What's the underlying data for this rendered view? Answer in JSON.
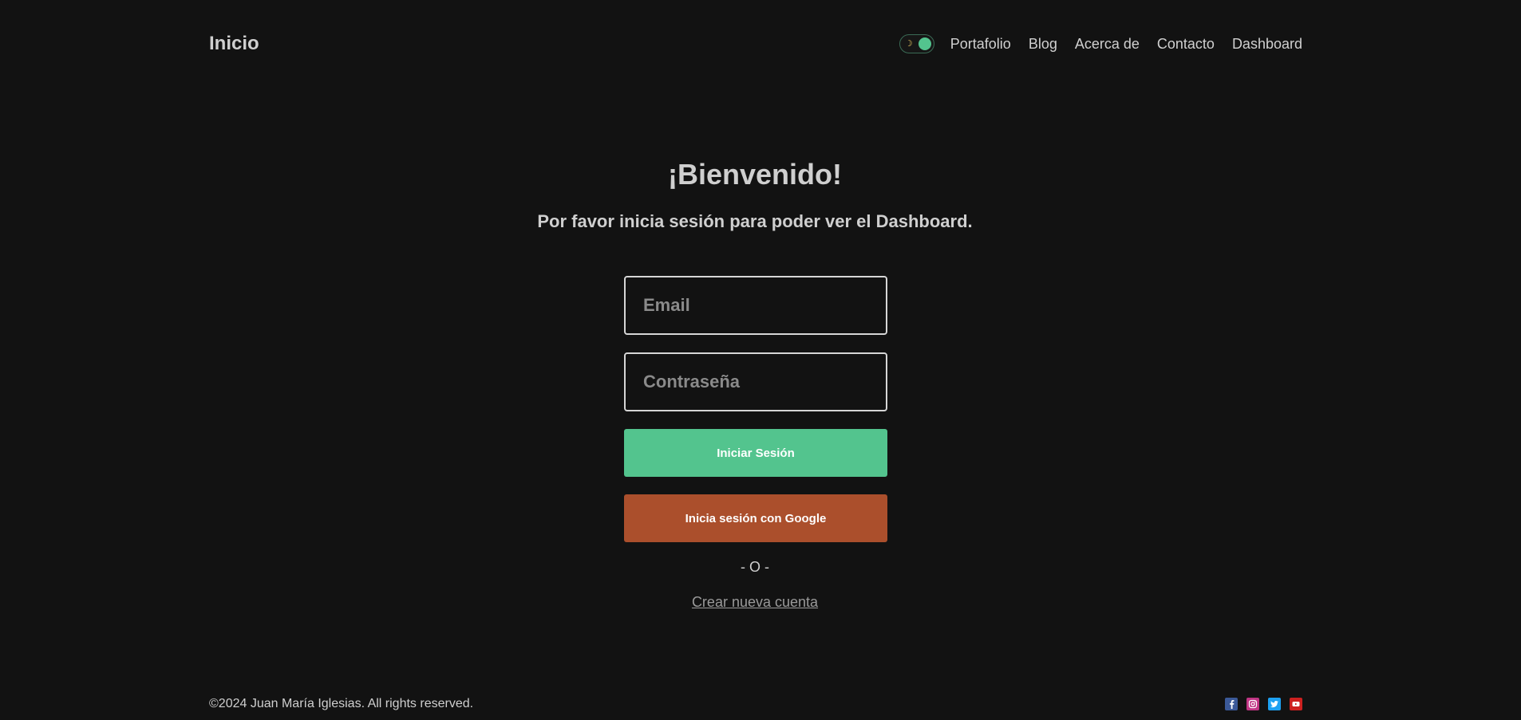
{
  "header": {
    "brand": "Inicio",
    "theme_toggle": {
      "icon": "moon-icon",
      "state": "dark",
      "accent": "#53c48e"
    },
    "nav": [
      {
        "label": "Portafolio"
      },
      {
        "label": "Blog"
      },
      {
        "label": "Acerca de"
      },
      {
        "label": "Contacto"
      },
      {
        "label": "Dashboard"
      }
    ]
  },
  "main": {
    "title": "¡Bienvenido!",
    "subtitle": "Por favor inicia sesión para poder ver el Dashboard.",
    "email": {
      "value": "",
      "placeholder": "Email"
    },
    "password": {
      "value": "",
      "placeholder": "Contraseña"
    },
    "login_button": "Iniciar Sesión",
    "google_button": "Inicia sesión con Google",
    "separator": "- O -",
    "create_account": "Crear nueva cuenta"
  },
  "footer": {
    "copyright": "©2024 Juan María Iglesias. All rights reserved.",
    "socials": [
      {
        "icon": "facebook-icon",
        "color": "#3b5998"
      },
      {
        "icon": "instagram-icon",
        "color": "#c13584"
      },
      {
        "icon": "twitter-icon",
        "color": "#1da1f2"
      },
      {
        "icon": "youtube-icon",
        "color": "#cd201f"
      }
    ]
  },
  "colors": {
    "background": "#121212",
    "primary": "#53c48e",
    "google": "#ab4f2c"
  }
}
